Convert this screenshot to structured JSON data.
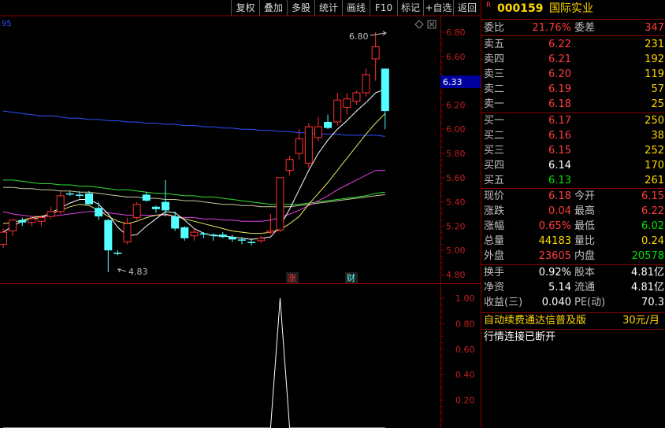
{
  "toolbar": {
    "items": [
      "复权",
      "叠加",
      "多股",
      "统计",
      "画线",
      "F10",
      "标记",
      "+自选",
      "返回"
    ]
  },
  "chart": {
    "top_left_label": "95",
    "high_label": "6.80",
    "low_label": "4.83",
    "current_price_tag": "6.33",
    "marker_zhang": "涨",
    "marker_cai": "财",
    "price_axis": [
      "6.80",
      "6.60",
      "6.40",
      "6.20",
      "6.00",
      "5.80",
      "5.60",
      "5.40",
      "5.20",
      "5.00",
      "4.80"
    ],
    "indicator_axis": [
      "1.00",
      "0.80",
      "0.60",
      "0.40",
      "0.20"
    ]
  },
  "chart_data": {
    "type": "candlestick",
    "price_ylim": [
      4.8,
      6.8
    ],
    "candles": [
      {
        "o": 5.05,
        "h": 5.18,
        "l": 5.02,
        "c": 5.15
      },
      {
        "o": 5.16,
        "h": 5.26,
        "l": 5.12,
        "c": 5.25
      },
      {
        "o": 5.25,
        "h": 5.27,
        "l": 5.2,
        "c": 5.23
      },
      {
        "o": 5.23,
        "h": 5.28,
        "l": 5.2,
        "c": 5.26
      },
      {
        "o": 5.24,
        "h": 5.29,
        "l": 5.2,
        "c": 5.27
      },
      {
        "o": 5.28,
        "h": 5.36,
        "l": 5.26,
        "c": 5.32
      },
      {
        "o": 5.32,
        "h": 5.5,
        "l": 5.3,
        "c": 5.45
      },
      {
        "o": 5.47,
        "h": 5.49,
        "l": 5.45,
        "c": 5.46
      },
      {
        "o": 5.46,
        "h": 5.49,
        "l": 5.43,
        "c": 5.45
      },
      {
        "o": 5.47,
        "h": 5.49,
        "l": 5.38,
        "c": 5.38
      },
      {
        "o": 5.35,
        "h": 5.4,
        "l": 5.25,
        "c": 5.28
      },
      {
        "o": 5.25,
        "h": 5.26,
        "l": 4.82,
        "c": 5.0
      },
      {
        "o": 4.98,
        "h": 5.0,
        "l": 4.96,
        "c": 4.97
      },
      {
        "o": 5.07,
        "h": 5.27,
        "l": 5.05,
        "c": 5.22
      },
      {
        "o": 5.27,
        "h": 5.4,
        "l": 5.25,
        "c": 5.38
      },
      {
        "o": 5.46,
        "h": 5.48,
        "l": 5.4,
        "c": 5.41
      },
      {
        "o": 5.36,
        "h": 5.37,
        "l": 5.31,
        "c": 5.34
      },
      {
        "o": 5.4,
        "h": 5.58,
        "l": 5.28,
        "c": 5.33
      },
      {
        "o": 5.28,
        "h": 5.32,
        "l": 5.16,
        "c": 5.18
      },
      {
        "o": 5.19,
        "h": 5.2,
        "l": 5.08,
        "c": 5.1
      },
      {
        "o": 5.12,
        "h": 5.18,
        "l": 5.08,
        "c": 5.15
      },
      {
        "o": 5.14,
        "h": 5.15,
        "l": 5.1,
        "c": 5.13
      },
      {
        "o": 5.13,
        "h": 5.14,
        "l": 5.08,
        "c": 5.12
      },
      {
        "o": 5.13,
        "h": 5.15,
        "l": 5.1,
        "c": 5.11
      },
      {
        "o": 5.11,
        "h": 5.13,
        "l": 5.07,
        "c": 5.09
      },
      {
        "o": 5.09,
        "h": 5.11,
        "l": 5.05,
        "c": 5.08
      },
      {
        "o": 5.07,
        "h": 5.1,
        "l": 5.04,
        "c": 5.06
      },
      {
        "o": 5.08,
        "h": 5.12,
        "l": 5.06,
        "c": 5.1
      },
      {
        "o": 5.15,
        "h": 5.3,
        "l": 5.13,
        "c": 5.16
      },
      {
        "o": 5.17,
        "h": 5.6,
        "l": 5.15,
        "c": 5.6
      },
      {
        "o": 5.66,
        "h": 5.78,
        "l": 5.62,
        "c": 5.75
      },
      {
        "o": 5.8,
        "h": 6.0,
        "l": 5.75,
        "c": 5.92
      },
      {
        "o": 5.72,
        "h": 6.05,
        "l": 5.68,
        "c": 6.02
      },
      {
        "o": 5.93,
        "h": 6.1,
        "l": 5.9,
        "c": 6.02
      },
      {
        "o": 6.06,
        "h": 6.12,
        "l": 6.0,
        "c": 6.01
      },
      {
        "o": 6.06,
        "h": 6.3,
        "l": 6.03,
        "c": 6.24
      },
      {
        "o": 6.18,
        "h": 6.3,
        "l": 6.12,
        "c": 6.25
      },
      {
        "o": 6.23,
        "h": 6.32,
        "l": 6.2,
        "c": 6.3
      },
      {
        "o": 6.3,
        "h": 6.5,
        "l": 6.27,
        "c": 6.45
      },
      {
        "o": 6.58,
        "h": 6.8,
        "l": 6.4,
        "c": 6.68
      },
      {
        "o": 6.5,
        "h": 6.5,
        "l": 6.0,
        "c": 6.15
      }
    ],
    "ma_white": [
      5.15,
      5.2,
      5.24,
      5.26,
      5.27,
      5.31,
      5.35,
      5.39,
      5.42,
      5.42,
      5.38,
      5.3,
      5.19,
      5.12,
      5.13,
      5.2,
      5.26,
      5.32,
      5.31,
      5.25,
      5.18,
      5.14,
      5.12,
      5.12,
      5.11,
      5.1,
      5.09,
      5.1,
      5.11,
      5.2,
      5.34,
      5.5,
      5.66,
      5.8,
      5.91,
      6.0,
      6.07,
      6.15,
      6.22,
      6.3,
      6.33
    ],
    "ma_yellow": [
      5.22,
      5.23,
      5.25,
      5.27,
      5.28,
      5.3,
      5.33,
      5.36,
      5.38,
      5.37,
      5.33,
      5.28,
      5.24,
      5.22,
      5.24,
      5.27,
      5.29,
      5.3,
      5.28,
      5.26,
      5.24,
      5.22,
      5.2,
      5.18,
      5.16,
      5.15,
      5.14,
      5.14,
      5.15,
      5.17,
      5.22,
      5.28,
      5.38,
      5.47,
      5.56,
      5.66,
      5.76,
      5.86,
      5.96,
      6.05,
      6.13
    ],
    "ma_purple": [
      5.32,
      5.3,
      5.29,
      5.28,
      5.28,
      5.28,
      5.29,
      5.3,
      5.31,
      5.32,
      5.32,
      5.31,
      5.3,
      5.29,
      5.29,
      5.29,
      5.29,
      5.29,
      5.28,
      5.27,
      5.27,
      5.26,
      5.26,
      5.25,
      5.25,
      5.24,
      5.24,
      5.24,
      5.25,
      5.27,
      5.3,
      5.33,
      5.37,
      5.41,
      5.45,
      5.5,
      5.54,
      5.58,
      5.62,
      5.66,
      5.66
    ],
    "ma_green": [
      5.58,
      5.58,
      5.57,
      5.56,
      5.55,
      5.55,
      5.54,
      5.54,
      5.53,
      5.53,
      5.52,
      5.51,
      5.5,
      5.5,
      5.49,
      5.48,
      5.47,
      5.47,
      5.46,
      5.45,
      5.45,
      5.44,
      5.44,
      5.43,
      5.42,
      5.41,
      5.4,
      5.39,
      5.38,
      5.38,
      5.38,
      5.38,
      5.39,
      5.4,
      5.41,
      5.42,
      5.43,
      5.44,
      5.45,
      5.47,
      5.48
    ],
    "ma_tan": [
      5.52,
      5.52,
      5.51,
      5.51,
      5.5,
      5.5,
      5.49,
      5.49,
      5.48,
      5.48,
      5.47,
      5.46,
      5.45,
      5.44,
      5.44,
      5.43,
      5.43,
      5.42,
      5.42,
      5.41,
      5.41,
      5.4,
      5.39,
      5.38,
      5.38,
      5.37,
      5.37,
      5.36,
      5.36,
      5.36,
      5.36,
      5.37,
      5.38,
      5.39,
      5.4,
      5.41,
      5.42,
      5.43,
      5.44,
      5.45,
      5.46
    ],
    "ma_blue": [
      6.15,
      6.14,
      6.13,
      6.12,
      6.11,
      6.11,
      6.1,
      6.09,
      6.09,
      6.08,
      6.08,
      6.07,
      6.07,
      6.06,
      6.06,
      6.05,
      6.05,
      6.04,
      6.04,
      6.03,
      6.03,
      6.02,
      6.02,
      6.01,
      6.01,
      6.0,
      6.0,
      5.99,
      5.99,
      5.98,
      5.98,
      5.97,
      5.97,
      5.96,
      5.96,
      5.96,
      5.95,
      5.95,
      5.95,
      5.95,
      5.94
    ],
    "indicator_ylim": [
      0.0,
      1.08
    ],
    "indicator": [
      0,
      0,
      0,
      0,
      0,
      0,
      0,
      0,
      0,
      0,
      0,
      0,
      0,
      0,
      0,
      0,
      0,
      0,
      0,
      0,
      0,
      0,
      0,
      0,
      0,
      0,
      0,
      0,
      0,
      1.0,
      0,
      0,
      0,
      0,
      0,
      0,
      0,
      0,
      0,
      0,
      0
    ],
    "colors": {
      "up": "#ff3030",
      "down": "#54ffff",
      "ma_white": "#ffffff",
      "ma_yellow": "#e8e860",
      "ma_purple": "#e040e0",
      "ma_green": "#30e030",
      "ma_tan": "#c8c8a0",
      "ma_blue": "#3050ff"
    }
  },
  "quote": {
    "flag": "R",
    "code": "000159",
    "name": "国际实业",
    "weibi_label": "委比",
    "weibi_value": "21.76%",
    "weicha_label": "委差",
    "weicha_value": "347",
    "sell": [
      {
        "label": "卖五",
        "price": "6.22",
        "vol": "231"
      },
      {
        "label": "卖四",
        "price": "6.21",
        "vol": "192"
      },
      {
        "label": "卖三",
        "price": "6.20",
        "vol": "119"
      },
      {
        "label": "卖二",
        "price": "6.19",
        "vol": "57"
      },
      {
        "label": "卖一",
        "price": "6.18",
        "vol": "25"
      }
    ],
    "buy": [
      {
        "label": "买一",
        "price": "6.17",
        "vol": "250"
      },
      {
        "label": "买二",
        "price": "6.16",
        "vol": "38"
      },
      {
        "label": "买三",
        "price": "6.15",
        "vol": "252"
      },
      {
        "label": "买四",
        "price": "6.14",
        "vol": "170"
      },
      {
        "label": "买五",
        "price": "6.13",
        "vol": "261"
      }
    ],
    "stats": [
      {
        "l1": "现价",
        "v1": "6.18",
        "l2": "今开",
        "v2": "6.15"
      },
      {
        "l1": "涨跌",
        "v1": "0.04",
        "l2": "最高",
        "v2": "6.22"
      },
      {
        "l1": "涨幅",
        "v1": "0.65%",
        "l2": "最低",
        "v2": "6.02"
      },
      {
        "l1": "总量",
        "v1": "44183",
        "l2": "量比",
        "v2": "0.24"
      },
      {
        "l1": "外盘",
        "v1": "23605",
        "l2": "内盘",
        "v2": "20578"
      }
    ],
    "fin": [
      {
        "l1": "换手",
        "v1": "0.92%",
        "l2": "股本",
        "v2": "4.81亿"
      },
      {
        "l1": "净资",
        "v1": "5.14",
        "l2": "流通",
        "v2": "4.81亿"
      },
      {
        "l1": "收益(三)",
        "v1": "0.040",
        "l2": "PE(动)",
        "v2": "70.3"
      }
    ],
    "promo_text": "自动续费通达信普及版",
    "promo_price": "30元/月",
    "status_text": "行情连接已断开"
  }
}
